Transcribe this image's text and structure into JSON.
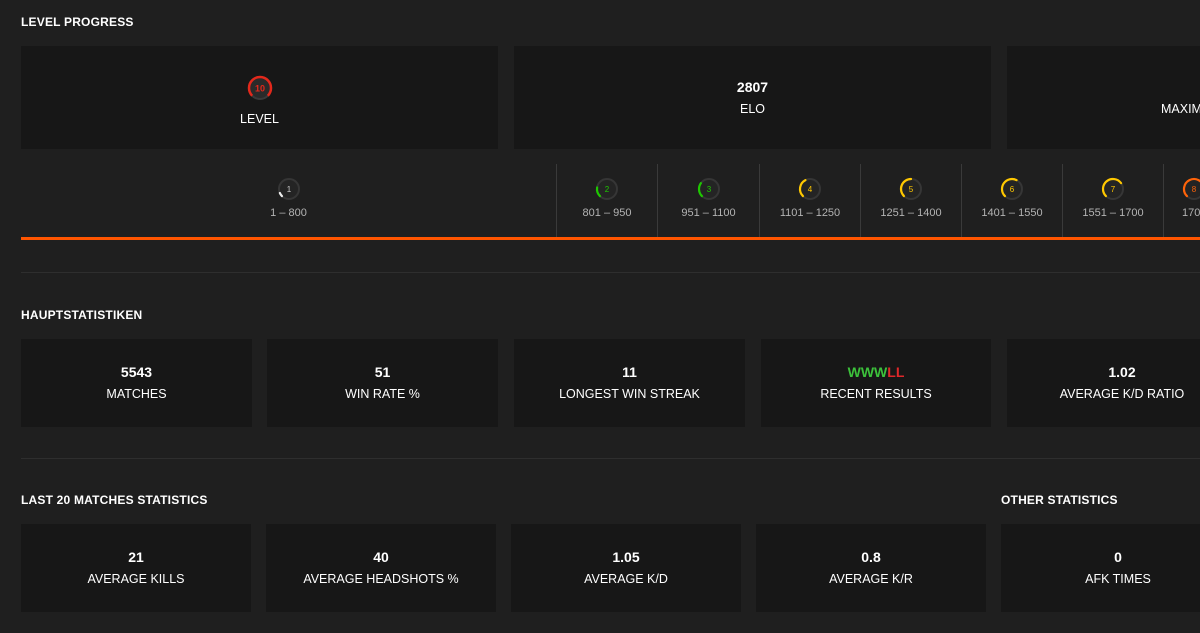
{
  "level_progress": {
    "title": "LEVEL PROGRESS",
    "current_level": {
      "value": "10",
      "label": "LEVEL",
      "color": "#e3281b"
    },
    "elo": {
      "value": "2807",
      "label": "ELO"
    },
    "max": {
      "label": "MAXIM"
    },
    "levels": [
      {
        "level": "1",
        "range": "1 – 800",
        "color": "#eeeeee",
        "fill": 0.08
      },
      {
        "level": "2",
        "range": "801 – 950",
        "color": "#1ec800",
        "fill": 0.2
      },
      {
        "level": "3",
        "range": "951 – 1100",
        "color": "#1ec800",
        "fill": 0.3
      },
      {
        "level": "4",
        "range": "1101 – 1250",
        "color": "#ffc800",
        "fill": 0.4
      },
      {
        "level": "5",
        "range": "1251 – 1400",
        "color": "#ffc800",
        "fill": 0.5
      },
      {
        "level": "6",
        "range": "1401 – 1550",
        "color": "#ffc800",
        "fill": 0.6
      },
      {
        "level": "7",
        "range": "1551 – 1700",
        "color": "#ffc800",
        "fill": 0.7
      },
      {
        "level": "8",
        "range": "170",
        "color": "#ff6309",
        "fill": 0.8
      }
    ],
    "bar_color": "#ff5500"
  },
  "main_stats": {
    "title": "HAUPTSTATISTIKEN",
    "matches": {
      "value": "5543",
      "label": "MATCHES"
    },
    "win_rate": {
      "value": "51",
      "label": "WIN RATE %"
    },
    "longest_streak": {
      "value": "11",
      "label": "LONGEST WIN STREAK"
    },
    "recent": {
      "wins": "WWW",
      "losses": "LL",
      "label": "RECENT RESULTS",
      "win_color": "#3cc13b",
      "loss_color": "#e0272a"
    },
    "kd": {
      "value": "1.02",
      "label": "AVERAGE K/D RATIO"
    }
  },
  "last20": {
    "title": "LAST 20 MATCHES STATISTICS",
    "kills": {
      "value": "21",
      "label": "AVERAGE KILLS"
    },
    "headshots": {
      "value": "40",
      "label": "AVERAGE HEADSHOTS %"
    },
    "kd": {
      "value": "1.05",
      "label": "AVERAGE K/D"
    },
    "kr": {
      "value": "0.8",
      "label": "AVERAGE K/R"
    }
  },
  "other": {
    "title": "OTHER STATISTICS",
    "afk": {
      "value": "0",
      "label": "AFK TIMES"
    }
  }
}
